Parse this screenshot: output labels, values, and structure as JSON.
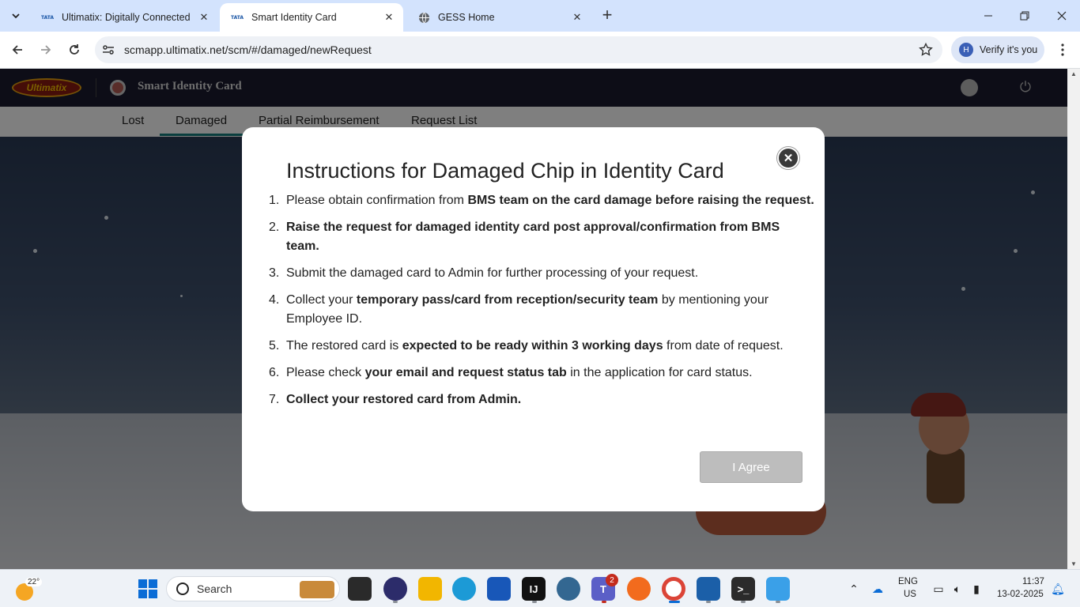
{
  "browser": {
    "tabs": [
      {
        "title": "Ultimatix: Digitally Connected",
        "favicon": "TATA",
        "active": false
      },
      {
        "title": "Smart Identity Card",
        "favicon": "TATA",
        "active": true
      },
      {
        "title": "GESS Home",
        "favicon": "globe-icon",
        "active": false
      }
    ],
    "url": "scmapp.ultimatix.net/scm/#/damaged/newRequest",
    "profile_initial": "H",
    "profile_label": "Verify it's you"
  },
  "app": {
    "logo_text": "Ultimatix",
    "title": "Smart Identity Card",
    "nav": [
      "Lost",
      "Damaged",
      "Partial Reimbursement",
      "Request List"
    ],
    "active_nav": "Damaged"
  },
  "modal": {
    "title": "Instructions for Damaged Chip in Identity Card",
    "close_symbol": "✕",
    "items": [
      {
        "num": "1.",
        "pre": "Please obtain confirmation from ",
        "bold": "BMS team on the card damage before raising the request.",
        "post": ""
      },
      {
        "num": "2.",
        "pre": "",
        "bold": "Raise the request for damaged identity card post approval/confirmation from BMS team.",
        "post": ""
      },
      {
        "num": "3.",
        "pre": "Submit the damaged card to Admin for further processing of your request.",
        "bold": "",
        "post": ""
      },
      {
        "num": "4.",
        "pre": "Collect your ",
        "bold": "temporary pass/card from reception/security team",
        "post": " by mentioning your Employee ID."
      },
      {
        "num": "5.",
        "pre": "The restored card is ",
        "bold": "expected to be ready within 3 working days",
        "post": " from date of request."
      },
      {
        "num": "6.",
        "pre": "Please check ",
        "bold": "your email and request status tab",
        "post": " in the application for card status."
      },
      {
        "num": "7.",
        "pre": "",
        "bold": "Collect your restored card from Admin.",
        "post": ""
      }
    ],
    "agree_label": "I Agree"
  },
  "taskbar": {
    "temperature": "22°",
    "search_label": "Search",
    "teams_badge": "2",
    "language": "ENG",
    "region": "US",
    "time": "11:37",
    "date": "13-02-2025"
  }
}
